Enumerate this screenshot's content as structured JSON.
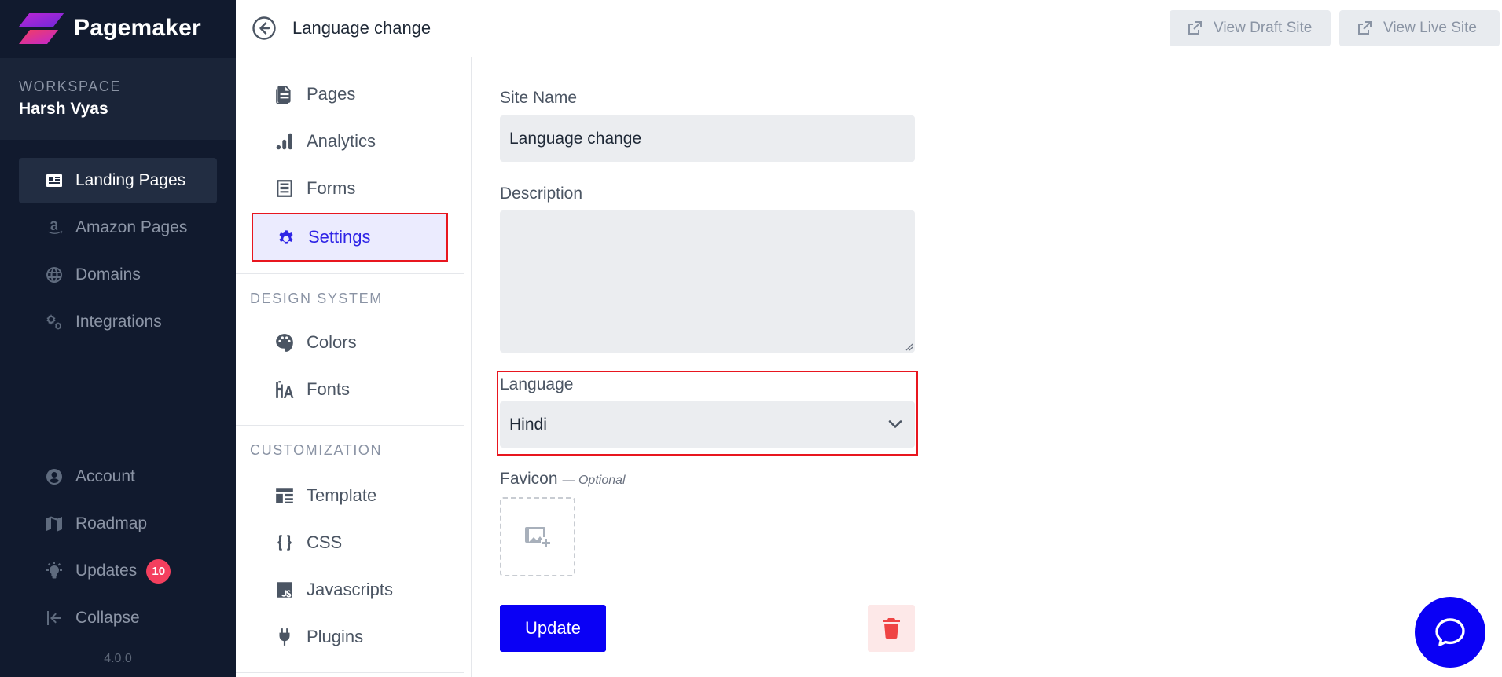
{
  "app": {
    "name": "Pagemaker",
    "version": "4.0.0"
  },
  "workspace": {
    "label": "WORKSPACE",
    "name": "Harsh Vyas"
  },
  "sidebar": {
    "main_items": [
      {
        "label": "Landing Pages",
        "icon": "newspaper-icon",
        "active": true
      },
      {
        "label": "Amazon Pages",
        "icon": "amazon-icon"
      },
      {
        "label": "Domains",
        "icon": "globe-icon"
      },
      {
        "label": "Integrations",
        "icon": "cogs-icon"
      }
    ],
    "bottom_items": [
      {
        "label": "Account",
        "icon": "user-circle-icon"
      },
      {
        "label": "Roadmap",
        "icon": "map-icon"
      },
      {
        "label": "Updates",
        "icon": "lightbulb-icon",
        "badge": "10"
      },
      {
        "label": "Collapse",
        "icon": "collapse-left-icon"
      }
    ]
  },
  "topbar": {
    "page_name": "Language change",
    "view_draft_label": "View Draft Site",
    "view_live_label": "View Live Site"
  },
  "subnav": {
    "items": [
      {
        "label": "Pages",
        "icon": "file-icon"
      },
      {
        "label": "Analytics",
        "icon": "bar-chart-icon"
      },
      {
        "label": "Forms",
        "icon": "form-icon"
      },
      {
        "label": "Settings",
        "icon": "gear-icon",
        "active": true
      }
    ],
    "design_system": {
      "title": "DESIGN SYSTEM",
      "items": [
        {
          "label": "Colors",
          "icon": "palette-icon"
        },
        {
          "label": "Fonts",
          "icon": "font-icon"
        }
      ]
    },
    "customization": {
      "title": "CUSTOMIZATION",
      "items": [
        {
          "label": "Template",
          "icon": "layout-icon"
        },
        {
          "label": "CSS",
          "icon": "braces-icon"
        },
        {
          "label": "Javascripts",
          "icon": "js-icon"
        },
        {
          "label": "Plugins",
          "icon": "plug-icon"
        }
      ]
    }
  },
  "form": {
    "site_name_label": "Site Name",
    "site_name_value": "Language change",
    "description_label": "Description",
    "description_value": "",
    "language_label": "Language",
    "language_value": "Hindi",
    "favicon_label": "Favicon",
    "favicon_optional": "— Optional",
    "update_label": "Update"
  },
  "colors": {
    "accent": "#0a00f5",
    "sidebar_bg": "#111a2e",
    "highlight_border": "#e8161f",
    "badge": "#f43f5e"
  }
}
